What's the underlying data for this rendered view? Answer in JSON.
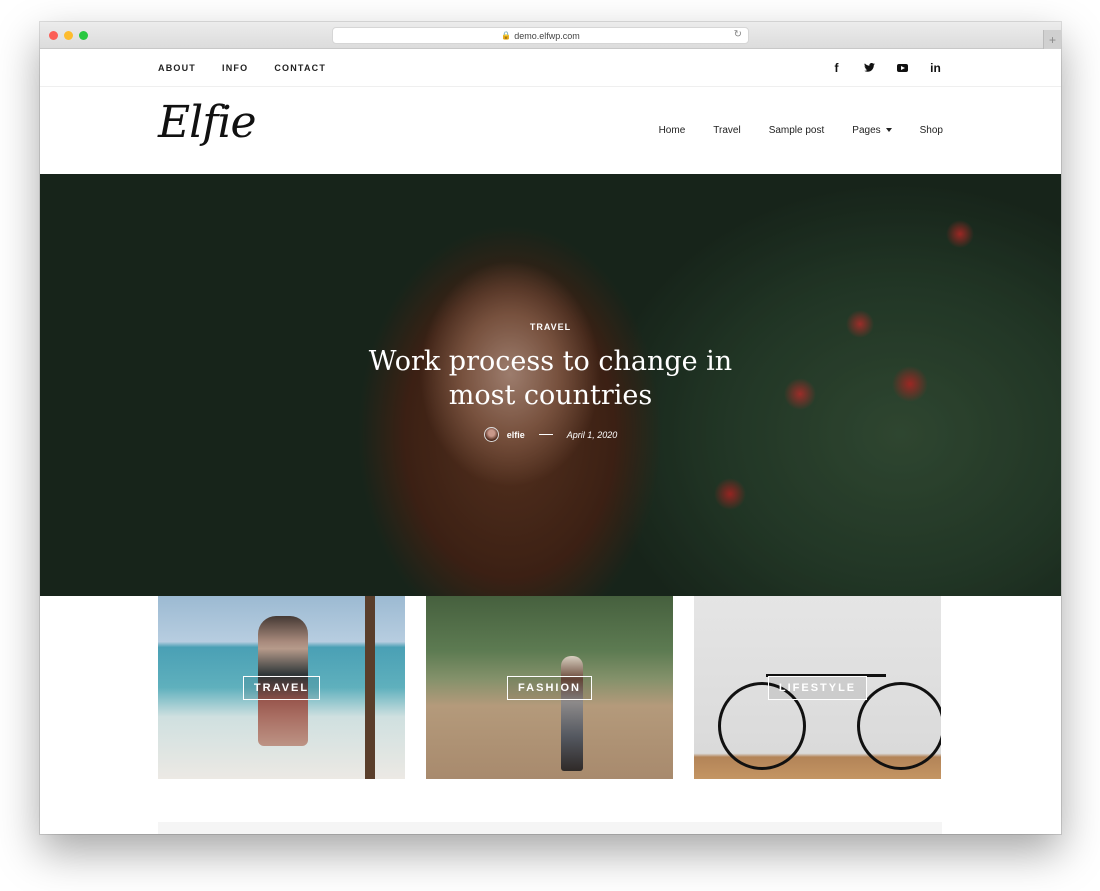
{
  "browser": {
    "url": "demo.elfwp.com",
    "new_tab_label": "+"
  },
  "topbar": {
    "links": [
      "ABOUT",
      "INFO",
      "CONTACT"
    ],
    "social": [
      {
        "name": "facebook",
        "glyph": "f"
      },
      {
        "name": "twitter",
        "glyph": "🐦"
      },
      {
        "name": "youtube",
        "glyph": ""
      },
      {
        "name": "linkedin",
        "glyph": "in"
      }
    ]
  },
  "header": {
    "logo": "Elfie",
    "nav": [
      "Home",
      "Travel",
      "Sample post",
      "Pages",
      "Shop"
    ]
  },
  "hero": {
    "category": "TRAVEL",
    "title": "Work process to change in most countries",
    "author": "elfie",
    "date": "April 1, 2020"
  },
  "categories": [
    {
      "label": "TRAVEL"
    },
    {
      "label": "FASHION"
    },
    {
      "label": "LIFESTYLE"
    }
  ]
}
